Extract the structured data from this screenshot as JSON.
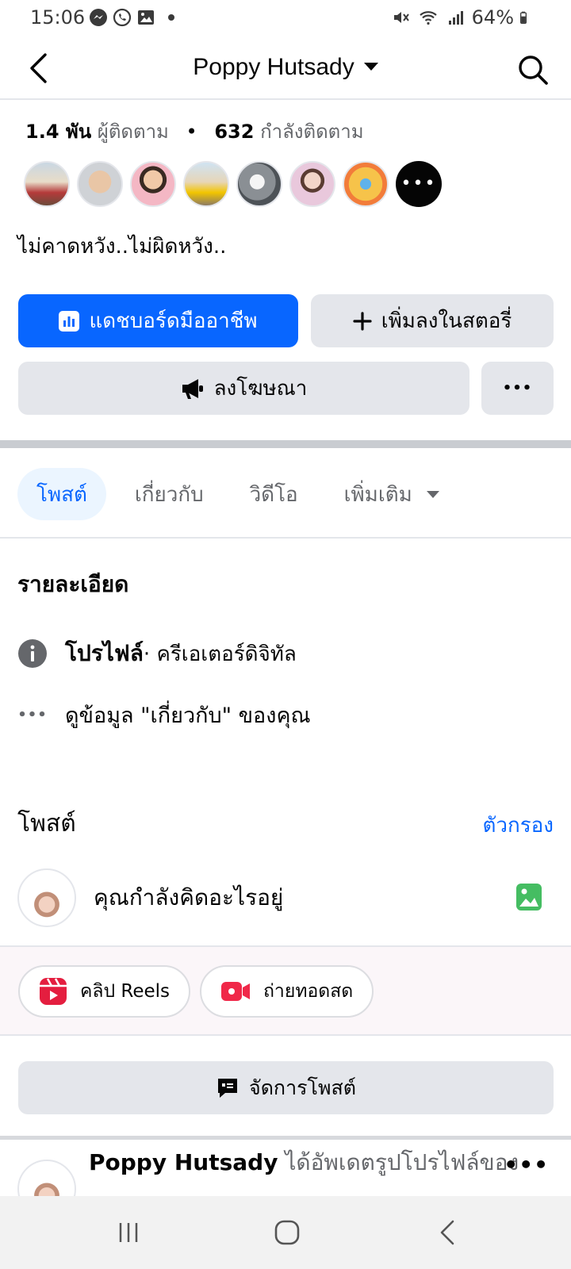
{
  "status_bar": {
    "time": "15:06",
    "battery": "64%",
    "left_icons": [
      "messenger-icon",
      "whatsapp-icon",
      "gallery-icon",
      "dot-icon"
    ],
    "right_icons": [
      "mute-icon",
      "wifi-icon",
      "signal-icon",
      "battery-icon"
    ]
  },
  "header": {
    "title": "Poppy Hutsady"
  },
  "stats": {
    "followers_count": "1.4 พัน",
    "followers_label": "ผู้ติดตาม",
    "following_count": "632",
    "following_label": "กำลังติดตาม"
  },
  "friends": {
    "count_shown": 7,
    "more_label": "•••"
  },
  "bio": "ไม่คาดหวัง..ไม่ผิดหวัง..",
  "actions": {
    "dashboard_label": "แดชบอร์ดมืออาชีพ",
    "add_story_label": "เพิ่มลงในสตอรี่",
    "advertise_label": "ลงโฆษณา",
    "more_label": "•••"
  },
  "tabs": [
    {
      "label": "โพสต์",
      "active": true
    },
    {
      "label": "เกี่ยวกับ",
      "active": false
    },
    {
      "label": "วิดีโอ",
      "active": false
    },
    {
      "label": "เพิ่มเติม",
      "active": false
    }
  ],
  "details": {
    "title": "รายละเอียด",
    "profile_label": "โปรไฟล์",
    "profile_category": " · ครีเอเตอร์ดิจิทัล",
    "see_about": "ดูข้อมูล \"เกี่ยวกับ\" ของคุณ"
  },
  "posts": {
    "title": "โพสต์",
    "filter_label": "ตัวกรอง",
    "composer_prompt": "คุณกำลังคิดอะไรอยู่",
    "reels_label": "คลิป Reels",
    "live_label": "ถ่ายทอดสด",
    "manage_label": "จัดการโพสต์"
  },
  "post_item": {
    "author": "Poppy Hutsady",
    "action_text": " ได้อัพเดตรูปโปรไฟล์ของ",
    "more_label": "•••"
  },
  "colors": {
    "accent": "#0866ff",
    "secondary_button": "#e4e6eb",
    "reels_red": "#e41e3f",
    "live_red": "#f02849",
    "photo_green": "#45bd62"
  }
}
